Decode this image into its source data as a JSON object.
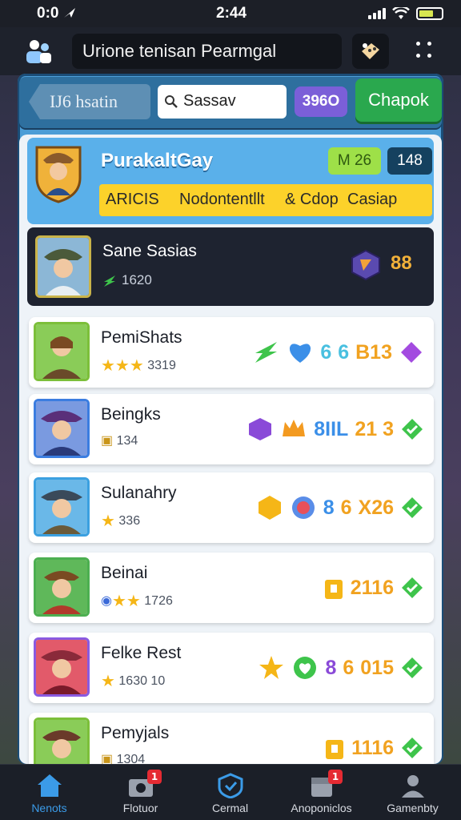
{
  "status_bar": {
    "time_left": "0:0",
    "time_center": "2:44"
  },
  "top_bar": {
    "title": "Urione tenisan Pearmgal"
  },
  "nav": {
    "back_label": "IJ6 hsatin",
    "search_value": "Sassav",
    "badge": "396O",
    "action_label": "Chapok"
  },
  "header_card": {
    "name": "PurakaltGay",
    "pill_green": "M 26",
    "pill_dark": "148",
    "tabs": [
      "ARICIS",
      "Nodontentllt",
      "& Cdop",
      "Casiap"
    ]
  },
  "featured": {
    "name": "Sane Sasias",
    "sub_value": "1620",
    "score": "88"
  },
  "rows": [
    {
      "name": "PemiShats",
      "sub": "3319",
      "stars": 3,
      "icon_text": [
        "6",
        "6",
        "B13"
      ],
      "colors": [
        "#3ec44b",
        "#3b8fe8",
        "#49c0e0",
        "#49c0e0",
        "#f1a220",
        "#a34be0"
      ]
    },
    {
      "name": "Beingks",
      "sub": "134",
      "stars": 0,
      "icon_text": [
        "8IIL",
        "21 3"
      ]
    },
    {
      "name": "Sulanahry",
      "sub": "336",
      "stars": 1,
      "icon_text": [
        "8",
        "6",
        "X26"
      ]
    },
    {
      "name": "Beinai",
      "sub": "1726",
      "stars": 2,
      "icon_text": [
        "2116"
      ]
    },
    {
      "name": "Felke Rest",
      "sub": "1630 10",
      "stars": 1,
      "icon_text": [
        "8",
        "6",
        "015"
      ]
    },
    {
      "name": "Pemyjals",
      "sub": "1304",
      "stars": 0,
      "icon_text": [
        "1116"
      ]
    }
  ],
  "bottom_nav": [
    {
      "label": "Nenots",
      "active": true,
      "badge": ""
    },
    {
      "label": "Flotuor",
      "active": false,
      "badge": "1"
    },
    {
      "label": "Cermal",
      "active": false,
      "badge": ""
    },
    {
      "label": "Anoponiclos",
      "active": false,
      "badge": "1"
    },
    {
      "label": "Gamenbty",
      "active": false,
      "badge": ""
    }
  ],
  "colors": {
    "accent": "#3b9be8",
    "gold": "#f2b13a",
    "green": "#2aa84e",
    "panel": "#eef3f8"
  }
}
